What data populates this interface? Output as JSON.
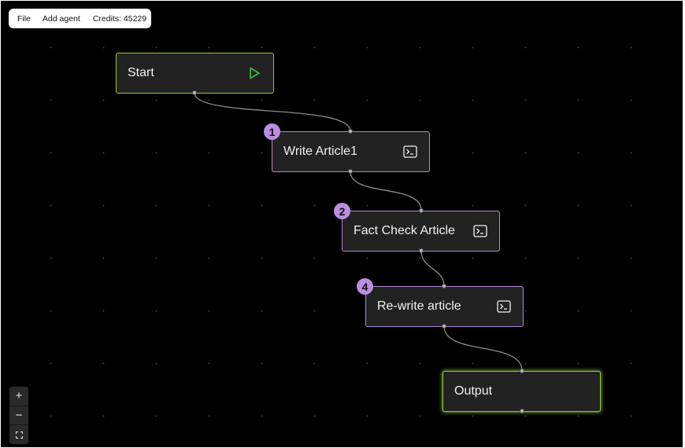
{
  "menubar": {
    "file_label": "File",
    "add_agent_label": "Add agent",
    "credits_label": "Credits: 45229"
  },
  "nodes": {
    "start": {
      "label": "Start",
      "icon": "play-icon",
      "border_color": "#95c93e"
    },
    "write_article": {
      "label": "Write Article1",
      "badge": "1",
      "icon": "terminal-icon",
      "border_color": "#b187d6"
    },
    "fact_check": {
      "label": "Fact Check Article",
      "badge": "2",
      "icon": "terminal-icon",
      "border_color": "#b187d6"
    },
    "rewrite": {
      "label": "Re-write article",
      "badge": "4",
      "icon": "terminal-icon",
      "border_color": "#b187d6"
    },
    "output": {
      "label": "Output",
      "border_color": "#95c93e"
    }
  },
  "zoom_controls": {
    "zoom_in": "+",
    "zoom_out": "−",
    "fit_view_icon": "fit-view-icon"
  },
  "colors": {
    "canvas_bg": "#000000",
    "node_bg": "#222222",
    "agent_border": "#b187d6",
    "io_border": "#95c93e",
    "badge_bg": "#bb8ee0",
    "play_icon": "#3fb950"
  }
}
